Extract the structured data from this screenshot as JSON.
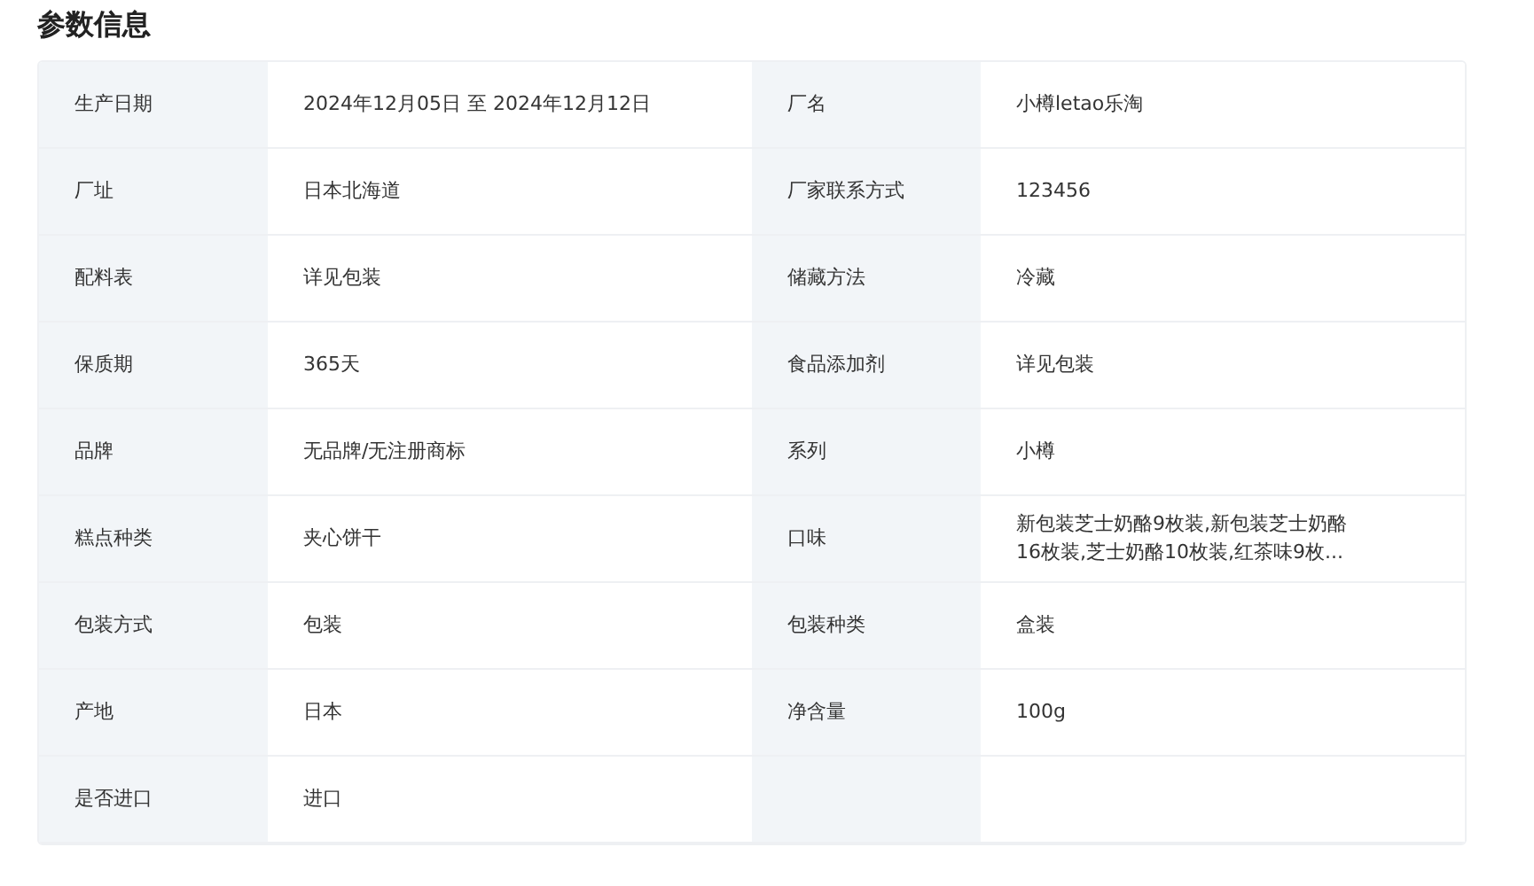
{
  "title": "参数信息",
  "rows": [
    [
      {
        "label": "生产日期",
        "value": "2024年12月05日 至 2024年12月12日"
      },
      {
        "label": "厂名",
        "value": "小樽letao乐淘"
      }
    ],
    [
      {
        "label": "厂址",
        "value": "日本北海道"
      },
      {
        "label": "厂家联系方式",
        "value": "123456"
      }
    ],
    [
      {
        "label": "配料表",
        "value": "详见包装"
      },
      {
        "label": "储藏方法",
        "value": "冷藏"
      }
    ],
    [
      {
        "label": "保质期",
        "value": "365天"
      },
      {
        "label": "食品添加剂",
        "value": "详见包装"
      }
    ],
    [
      {
        "label": "品牌",
        "value": "无品牌/无注册商标"
      },
      {
        "label": "系列",
        "value": "小樽"
      }
    ],
    [
      {
        "label": "糕点种类",
        "value": "夹心饼干"
      },
      {
        "label": "口味",
        "value": "新包装芝士奶酪9枚装,新包装芝士奶酪16枚装,芝士奶酪10枚装,红茶味9枚..."
      }
    ],
    [
      {
        "label": "包装方式",
        "value": "包装"
      },
      {
        "label": "包装种类",
        "value": "盒装"
      }
    ],
    [
      {
        "label": "产地",
        "value": "日本"
      },
      {
        "label": "净含量",
        "value": "100g"
      }
    ],
    [
      {
        "label": "是否进口",
        "value": "进口"
      }
    ]
  ]
}
